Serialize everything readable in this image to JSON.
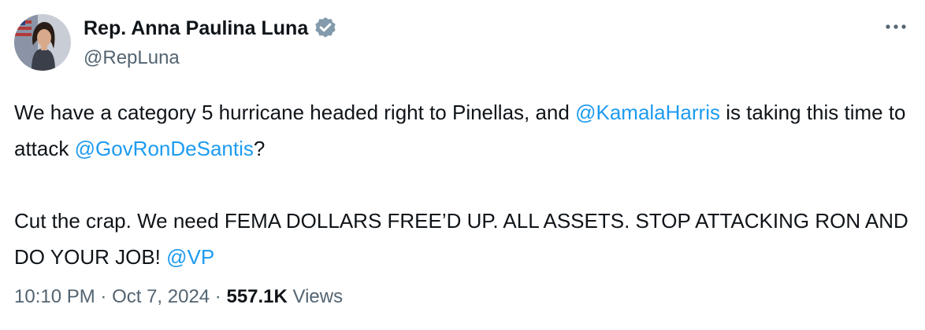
{
  "author": {
    "display_name": "Rep. Anna Paulina Luna",
    "handle": "@RepLuna",
    "verified_icon": "verified-badge-gray"
  },
  "tweet": {
    "line1_prefix": "We have a category 5 hurricane headed right to Pinellas, and ",
    "mention_1": "@KamalaHarris",
    "line1_suffix": " is taking this time to attack ",
    "mention_2": "@GovRonDeSantis",
    "line1_end": "?",
    "paragraph2_text": "Cut the crap. We need FEMA DOLLARS FREE’D UP. ALL ASSETS. STOP ATTACKING RON AND DO YOUR JOB! ",
    "mention_3": "@VP"
  },
  "meta": {
    "time": "10:10 PM",
    "separator": " · ",
    "date": "Oct 7, 2024",
    "views_count": "557.1K",
    "views_label": " Views"
  },
  "colors": {
    "link": "#1d9bf0",
    "text": "#0f1419",
    "secondary": "#536471",
    "verified": "#829aab"
  }
}
